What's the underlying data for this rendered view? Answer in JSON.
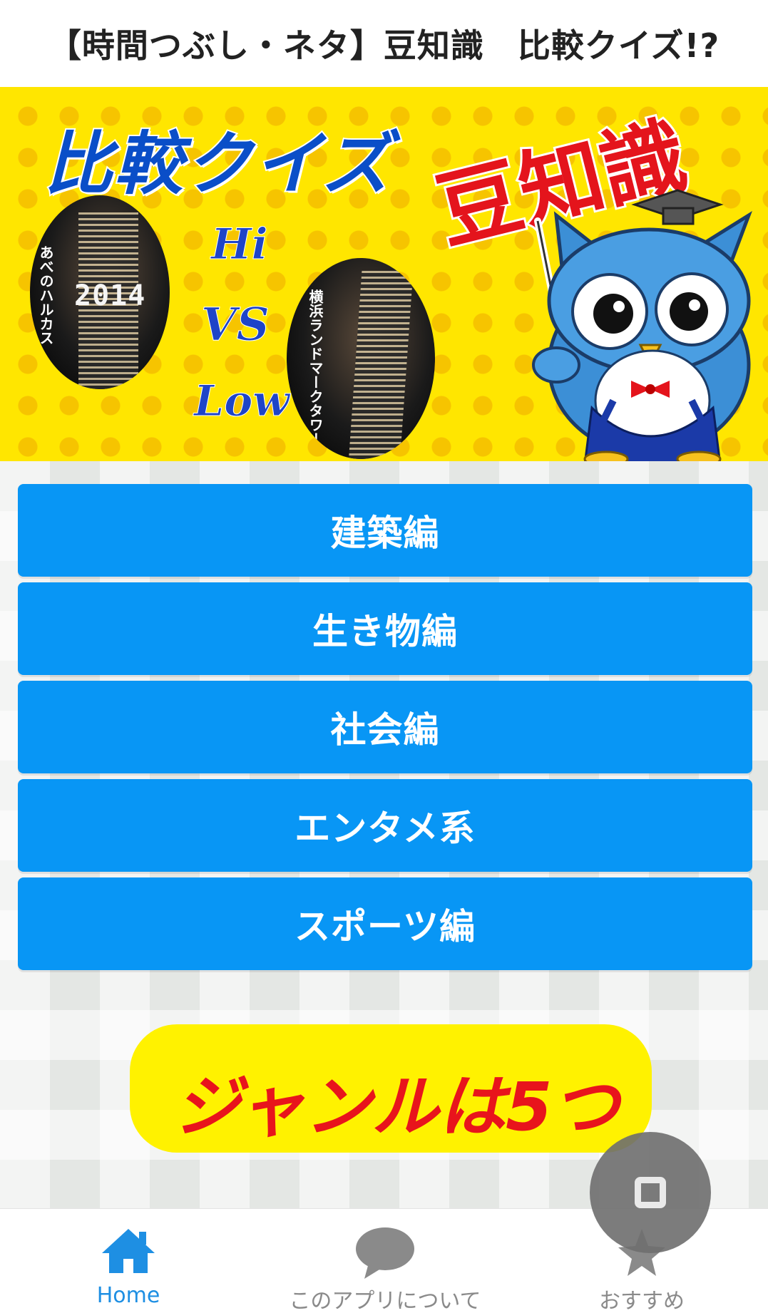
{
  "header": {
    "title": "【時間つぶし・ネタ】豆知識　比較クイズ!?"
  },
  "banner": {
    "title": "比較クイズ",
    "subtitle": "豆知識",
    "hi": "Hi",
    "vs": "VS",
    "low": "Low",
    "left_photo_label": "あべのハルカス",
    "left_photo_number": "2014",
    "right_photo_label": "横浜ランドマークタワー"
  },
  "genres": [
    {
      "label": "建築編"
    },
    {
      "label": "生き物編"
    },
    {
      "label": "社会編"
    },
    {
      "label": "エンタメ系"
    },
    {
      "label": "スポーツ編"
    }
  ],
  "promo": {
    "text": "ジャンルは5つ"
  },
  "bottom_nav": {
    "items": [
      {
        "label": "Home",
        "icon": "home-icon",
        "active": true
      },
      {
        "label": "このアプリについて",
        "icon": "speech-bubble-icon",
        "active": false
      },
      {
        "label": "おすすめ",
        "icon": "star-badge-icon",
        "active": false
      }
    ]
  },
  "fab": {
    "icon": "square-stop-icon"
  },
  "colors": {
    "button_blue": "#0896f5",
    "banner_yellow": "#ffe600",
    "title_blue": "#0a4ec8",
    "accent_red": "#e4141c",
    "nav_active": "#1e8fe3"
  }
}
